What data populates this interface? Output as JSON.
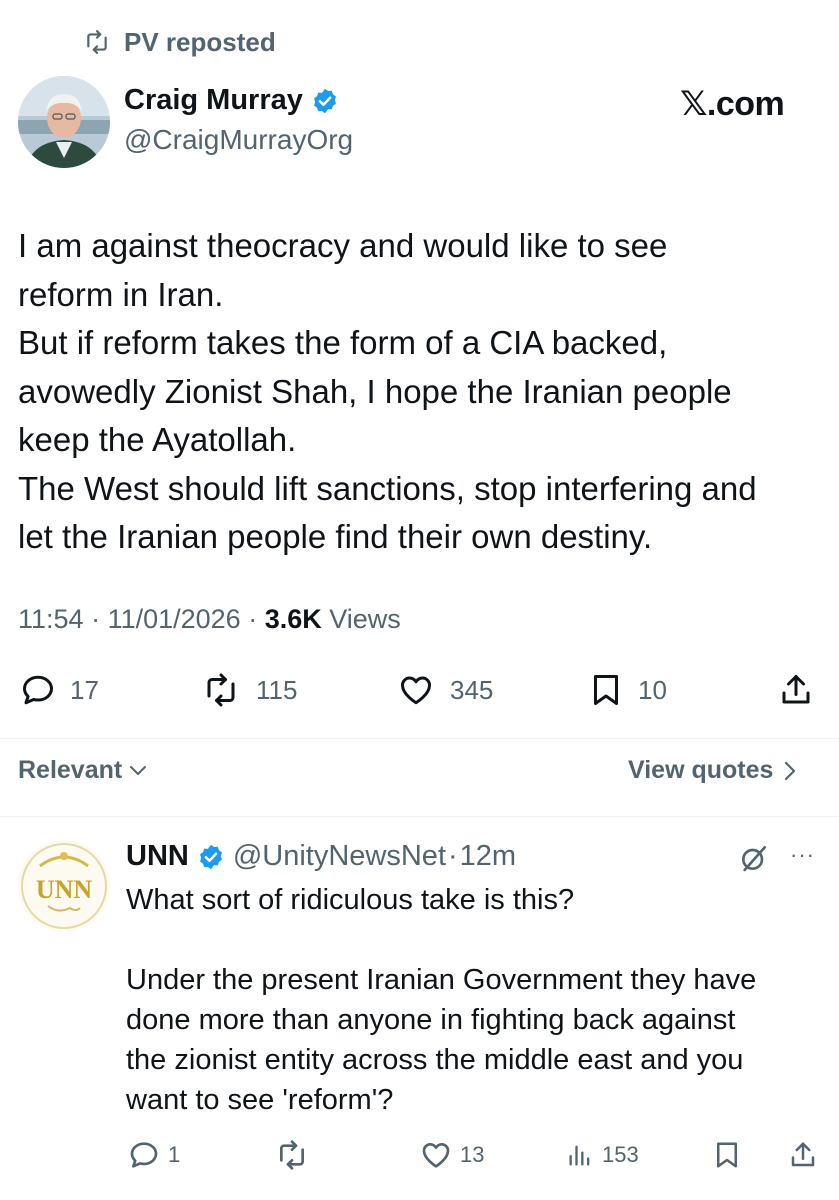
{
  "repost": {
    "label": "PV reposted",
    "icon": "repost-icon"
  },
  "tweet": {
    "author_name": "Craig Murray",
    "author_handle": "@CraigMurrayOrg",
    "verified": true,
    "source_label": "𝕏.com",
    "lines": [
      "I am against theocracy and would like to see",
      "reform in Iran.",
      "But if reform takes the form of a CIA backed,",
      "avowedly Zionist Shah, I hope the Iranian people",
      "keep the Ayatollah.",
      "The West should lift sanctions, stop interfering and",
      "let the Iranian people find their own destiny."
    ],
    "time": "11:54",
    "sep1": " · ",
    "date": "11/01/2026",
    "sep2": " · ",
    "views_count": "3.6K",
    "views_label": " Views",
    "stats": {
      "replies": "17",
      "reposts": "115",
      "likes": "345",
      "bookmarks": "10"
    }
  },
  "replies_header": {
    "sort_label": "Relevant",
    "view_quotes_label": "View quotes"
  },
  "reply": {
    "author_name": "UNN",
    "author_handle": "@UnityNewsNet",
    "dot": "·",
    "time": "12m",
    "verified": true,
    "avatar_text": "UNN",
    "more_label": "···",
    "lines": [
      "What sort of ridiculous take is this?",
      "",
      "Under the present Iranian Government they have",
      "done more than anyone in fighting back against",
      "the zionist entity across the middle east and you",
      "want to see 'reform'?"
    ],
    "stats": {
      "replies": "1",
      "reposts": "",
      "likes": "13",
      "views": "153"
    }
  },
  "colors": {
    "text": "#0f1419",
    "secondary": "#536471",
    "verified": "#1d9bf0",
    "divider": "#eff3f4",
    "unn_gold": "#c9a227"
  }
}
